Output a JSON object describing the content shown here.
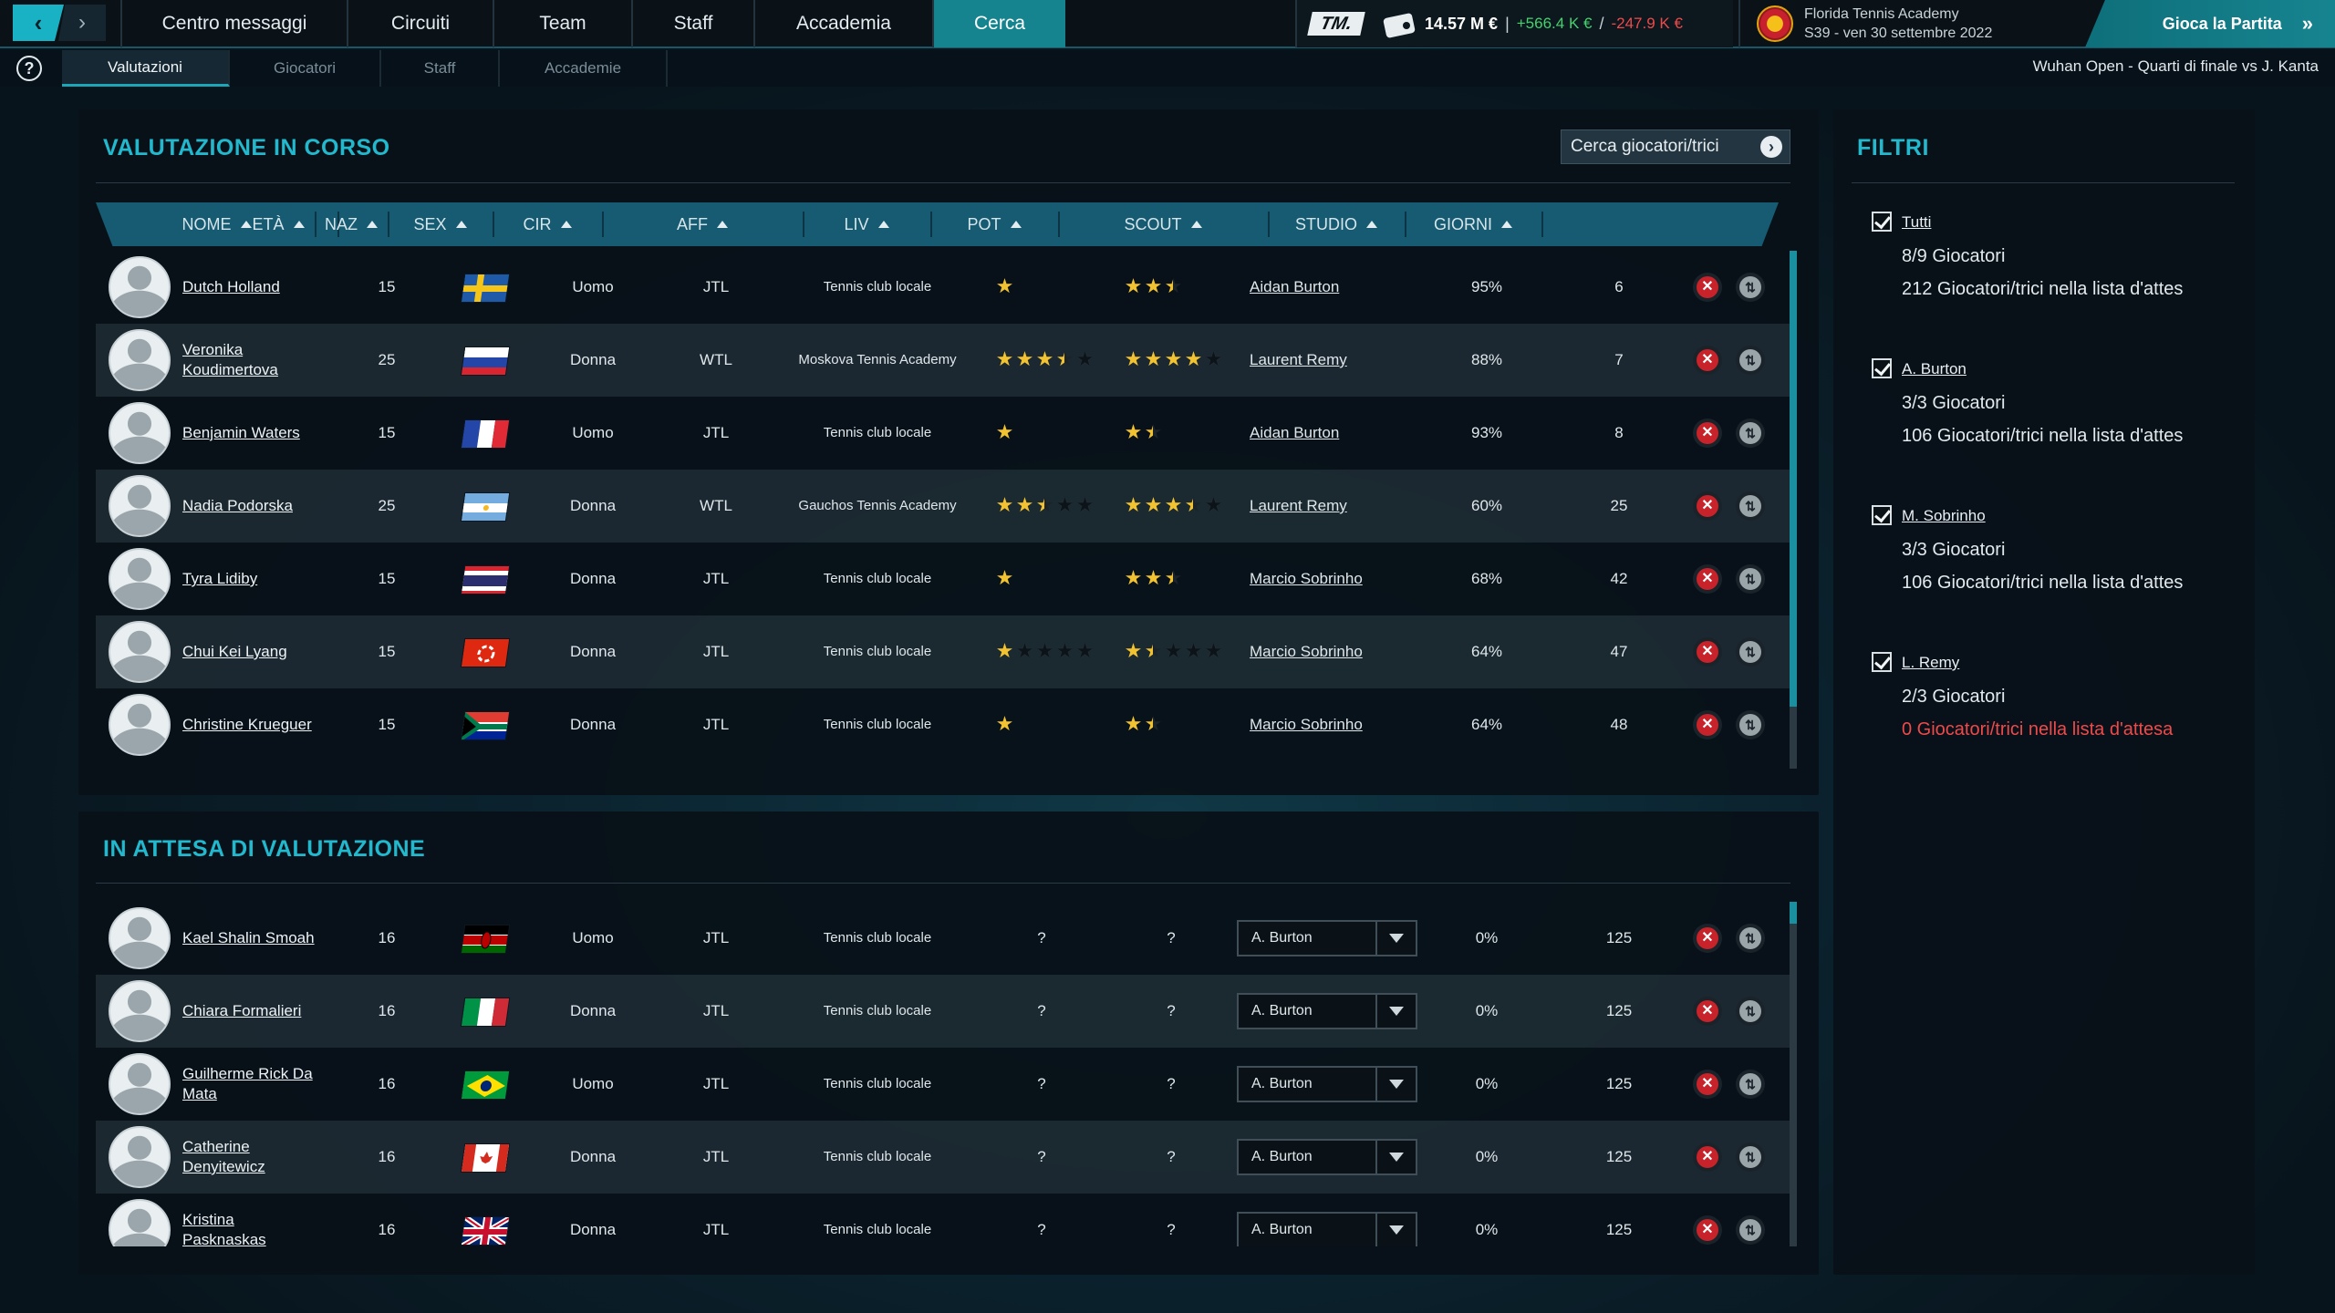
{
  "topbar": {
    "nav_items": [
      "Centro messaggi",
      "Circuiti",
      "Team",
      "Staff",
      "Accademia",
      "Cerca"
    ],
    "active_nav": "Cerca",
    "logo": "TM.",
    "balance": "14.57 M €",
    "income": "+566.4 K €",
    "slash": "/",
    "expense": "-247.9 K €",
    "club_name": "Florida Tennis Academy",
    "date": "S39 - ven 30 settembre 2022",
    "play_label": "Gioca la Partita"
  },
  "subbar": {
    "help": "?",
    "tabs": [
      "Valutazioni",
      "Giocatori",
      "Staff",
      "Accademie"
    ],
    "active_tab": "Valutazioni",
    "next_match": "Wuhan Open - Quarti di finale vs J. Kanta"
  },
  "in_progress": {
    "title": "VALUTAZIONE IN CORSO",
    "search_button": "Cerca giocatori/trici",
    "columns": [
      "NOME",
      "ETÀ",
      "NAZ",
      "SEX",
      "CIR",
      "AFF",
      "LIV",
      "POT",
      "SCOUT",
      "STUDIO",
      "GIORNI"
    ],
    "rows": [
      {
        "name": "Dutch Holland",
        "age": "15",
        "flag": "sweden",
        "sex": "Uomo",
        "cir": "JTL",
        "aff": "Tennis club locale",
        "liv": 1,
        "liv_slots": 1,
        "pot": 2.5,
        "pot_slots": 2.5,
        "scout": "Aidan Burton",
        "study": "95%",
        "days": "6"
      },
      {
        "name": "Veronika Koudimertova",
        "age": "25",
        "flag": "russia",
        "sex": "Donna",
        "cir": "WTL",
        "aff": "Moskova Tennis Academy",
        "liv": 3.5,
        "liv_slots": 5,
        "pot": 4,
        "pot_slots": 5,
        "scout": "Laurent Remy",
        "study": "88%",
        "days": "7"
      },
      {
        "name": "Benjamin Waters",
        "age": "15",
        "flag": "france",
        "sex": "Uomo",
        "cir": "JTL",
        "aff": "Tennis club locale",
        "liv": 1,
        "liv_slots": 1,
        "pot": 1.5,
        "pot_slots": 2,
        "scout": "Aidan Burton",
        "study": "93%",
        "days": "8"
      },
      {
        "name": "Nadia Podorska",
        "age": "25",
        "flag": "argentina",
        "sex": "Donna",
        "cir": "WTL",
        "aff": "Gauchos Tennis Academy",
        "liv": 2.5,
        "liv_slots": 5,
        "pot": 3.5,
        "pot_slots": 5,
        "scout": "Laurent Remy",
        "study": "60%",
        "days": "25"
      },
      {
        "name": "Tyra Lidiby",
        "age": "15",
        "flag": "thailand",
        "sex": "Donna",
        "cir": "JTL",
        "aff": "Tennis club locale",
        "liv": 1,
        "liv_slots": 1,
        "pot": 2.5,
        "pot_slots": 2.5,
        "scout": "Marcio Sobrinho",
        "study": "68%",
        "days": "42"
      },
      {
        "name": "Chui Kei Lyang",
        "age": "15",
        "flag": "hongkong",
        "sex": "Donna",
        "cir": "JTL",
        "aff": "Tennis club locale",
        "liv": 1,
        "liv_slots": 5,
        "pot": 1.5,
        "pot_slots": 5,
        "scout": "Marcio Sobrinho",
        "study": "64%",
        "days": "47"
      },
      {
        "name": "Christine Krueguer",
        "age": "15",
        "flag": "southafrica",
        "sex": "Donna",
        "cir": "JTL",
        "aff": "Tennis club locale",
        "liv": 1,
        "liv_slots": 1,
        "pot": 1.5,
        "pot_slots": 2,
        "scout": "Marcio Sobrinho",
        "study": "64%",
        "days": "48"
      }
    ]
  },
  "waiting": {
    "title": "IN ATTESA DI VALUTAZIONE",
    "rows": [
      {
        "name": "Kael Shalin Smoah",
        "age": "16",
        "flag": "kenya",
        "sex": "Uomo",
        "cir": "JTL",
        "aff": "Tennis club locale",
        "liv": "?",
        "pot": "?",
        "scout": "A. Burton",
        "study": "0%",
        "days": "125"
      },
      {
        "name": "Chiara Formalieri",
        "age": "16",
        "flag": "italy",
        "sex": "Donna",
        "cir": "JTL",
        "aff": "Tennis club locale",
        "liv": "?",
        "pot": "?",
        "scout": "A. Burton",
        "study": "0%",
        "days": "125"
      },
      {
        "name": "Guilherme Rick Da Mata",
        "age": "16",
        "flag": "brazil",
        "sex": "Uomo",
        "cir": "JTL",
        "aff": "Tennis club locale",
        "liv": "?",
        "pot": "?",
        "scout": "A. Burton",
        "study": "0%",
        "days": "125"
      },
      {
        "name": "Catherine Denyitewicz",
        "age": "16",
        "flag": "canada",
        "sex": "Donna",
        "cir": "JTL",
        "aff": "Tennis club locale",
        "liv": "?",
        "pot": "?",
        "scout": "A. Burton",
        "study": "0%",
        "days": "125"
      },
      {
        "name": "Kristina Pasknaskas",
        "age": "16",
        "flag": "uk",
        "sex": "Donna",
        "cir": "JTL",
        "aff": "Tennis club locale",
        "liv": "?",
        "pot": "?",
        "scout": "A. Burton",
        "study": "0%",
        "days": "125"
      }
    ]
  },
  "filters": {
    "title": "FILTRI",
    "groups": [
      {
        "label": "Tutti",
        "checked": true,
        "players": "8/9 Giocatori",
        "waiting": "212 Giocatori/trici nella lista d'attes",
        "waiting_red": false
      },
      {
        "label": "A. Burton",
        "checked": true,
        "players": "3/3 Giocatori",
        "waiting": "106 Giocatori/trici nella lista d'attes",
        "waiting_red": false
      },
      {
        "label": "M. Sobrinho",
        "checked": true,
        "players": "3/3 Giocatori",
        "waiting": "106 Giocatori/trici nella lista d'attes",
        "waiting_red": false
      },
      {
        "label": "L. Remy",
        "checked": true,
        "players": "2/3 Giocatori",
        "waiting": "0 Giocatori/trici nella lista d'attesa",
        "waiting_red": true
      }
    ]
  },
  "icons": {
    "remove": "close-icon",
    "swap": "swap-icon",
    "back": "chevron-left-icon",
    "forward": "chevron-right-icon"
  },
  "colors": {
    "accent": "#22b8cd",
    "active_tab": "#16848f",
    "income": "#43d36e",
    "expense": "#ef4a4a",
    "star": "#f2c230"
  }
}
